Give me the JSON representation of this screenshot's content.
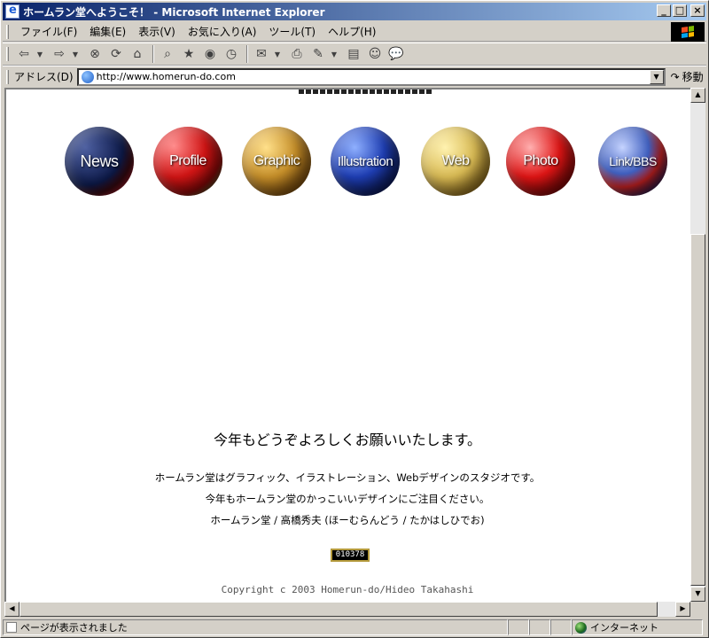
{
  "window": {
    "title": "ホームラン堂へようこそ！ - Microsoft Internet Explorer",
    "controls": [
      "minimize",
      "maximize",
      "close"
    ]
  },
  "menu": {
    "items": [
      "ファイル(F)",
      "編集(E)",
      "表示(V)",
      "お気に入り(A)",
      "ツール(T)",
      "ヘルプ(H)"
    ]
  },
  "toolbar": {
    "icons": [
      "back-icon",
      "forward-icon",
      "stop-icon",
      "refresh-icon",
      "home-icon",
      "search-icon",
      "favorites-icon",
      "media-icon",
      "history-icon",
      "mail-icon",
      "print-icon",
      "edit-icon",
      "discuss-icon",
      "messenger-icon"
    ]
  },
  "address": {
    "label": "アドレス(D)",
    "url": "http://www.homerun-do.com",
    "go_label": "移動"
  },
  "nav": {
    "balls": [
      "News",
      "Profile",
      "Graphic",
      "Illustration",
      "Web",
      "Photo",
      "Link/BBS"
    ]
  },
  "content": {
    "greeting": "今年もどうぞよろしくお願いいたします。",
    "line1": "ホームラン堂はグラフィック、イラストレーション、Webデザインのスタジオです。",
    "line2": "今年もホームラン堂のかっこいいデザインにご注目ください。",
    "line3": "ホームラン堂 / 高橋秀夫 (ほーむらんどう / たかはしひでお)",
    "counter": "010378",
    "copyright": "Copyright c 2003 Homerun-do/Hideo Takahashi"
  },
  "status": {
    "text": "ページが表示されました",
    "zone": "インターネット"
  }
}
